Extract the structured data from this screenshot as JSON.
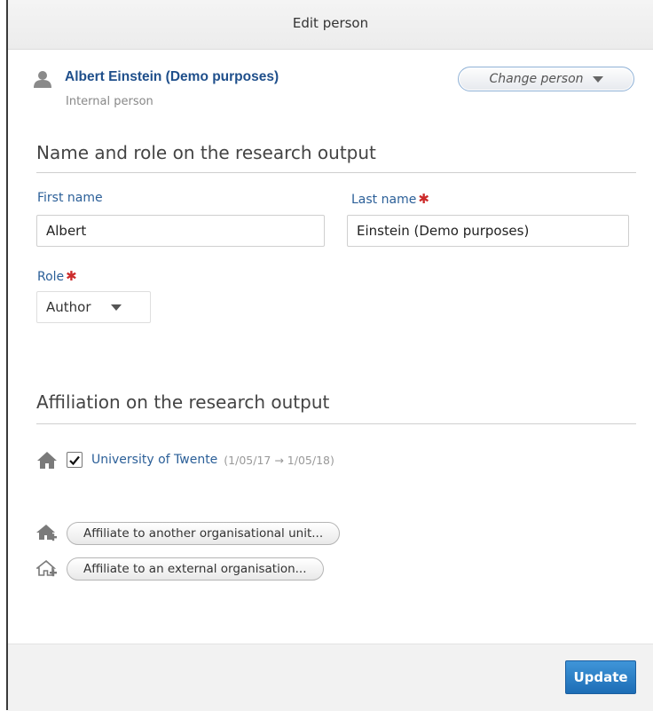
{
  "dialog": {
    "title": "Edit person"
  },
  "person": {
    "icon": "person-icon",
    "name": "Albert Einstein (Demo purposes)",
    "type": "Internal person",
    "change_button": "Change person"
  },
  "name_role_section": {
    "title": "Name and role on the research output",
    "first_name_label": "First name",
    "first_name_value": "Albert",
    "last_name_label": "Last name",
    "last_name_value": "Einstein (Demo purposes)",
    "required_marker": "✱",
    "role_label": "Role",
    "role_value": "Author"
  },
  "affiliation_section": {
    "title": "Affiliation on the research output",
    "affiliations": [
      {
        "icon": "house-icon",
        "checked": true,
        "org": "University of Twente",
        "dates": "(1/05/17 → 1/05/18)"
      }
    ],
    "add_internal_label": "Affiliate to another organisational unit...",
    "add_external_label": "Affiliate to an external organisation..."
  },
  "footer": {
    "update_label": "Update"
  },
  "colors": {
    "link": "#2b5f98",
    "name": "#1f4f8b",
    "required": "#cc2b2b",
    "primary_button": "#2a80c8"
  }
}
